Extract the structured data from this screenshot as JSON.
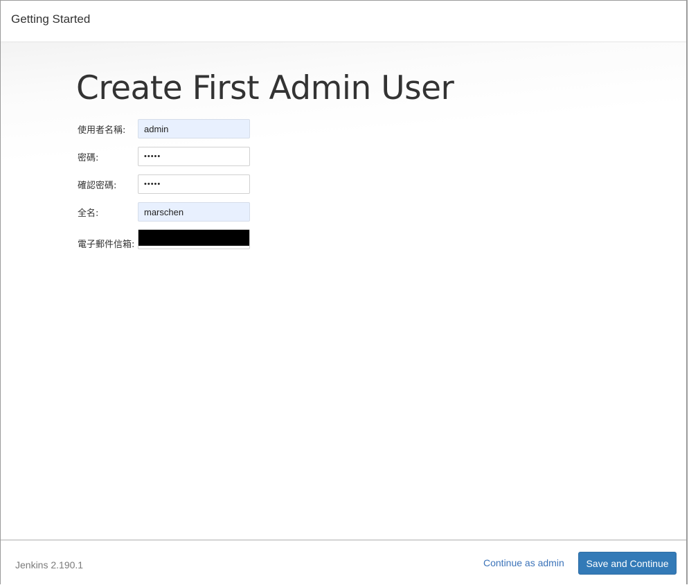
{
  "header": {
    "title": "Getting Started"
  },
  "main": {
    "title": "Create First Admin User",
    "form": {
      "username": {
        "label": "使用者名稱:",
        "value": "admin"
      },
      "password": {
        "label": "密碼:",
        "value": "•••••"
      },
      "confirm_password": {
        "label": "確認密碼:",
        "value": "•••••"
      },
      "full_name": {
        "label": "全名:",
        "value": "marschen"
      },
      "email": {
        "label": "電子郵件信箱:",
        "value": ""
      }
    }
  },
  "footer": {
    "version": "Jenkins 2.190.1",
    "continue_label": "Continue as admin",
    "save_label": "Save and Continue"
  },
  "colors": {
    "primary_button": "#337ab7",
    "link": "#3b73b9",
    "autofill_bg": "#e8f0fe"
  }
}
